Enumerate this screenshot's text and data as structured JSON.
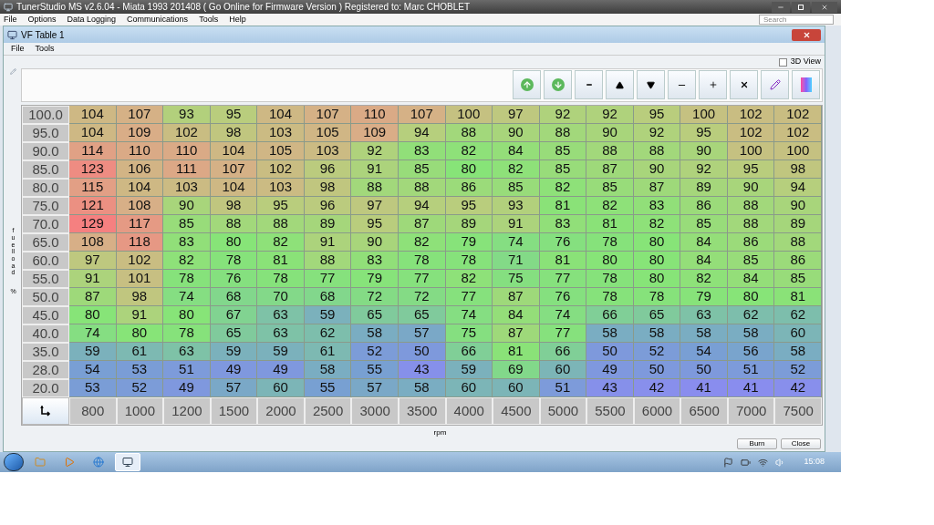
{
  "app_title": "TunerStudio MS v2.6.04 - Miata 1993 201408 ( Go Online for Firmware Version ) Registered to: Marc CHOBLET",
  "search": {
    "placeholder": "Search"
  },
  "main_menu": [
    "File",
    "Options",
    "Data Logging",
    "Communications",
    "Tools",
    "Help"
  ],
  "dialog": {
    "title": "VF Table 1",
    "menu": [
      "File",
      "Tools"
    ],
    "view_3d": {
      "label": "3D View",
      "checked": false
    },
    "y_label": "fuelload",
    "y_unit": "%",
    "x_label": "rpm",
    "rows": [
      {
        "load": "100.0",
        "cells": [
          "104",
          "107",
          "93",
          "95",
          "104",
          "107",
          "110",
          "107",
          "100",
          "97",
          "92",
          "92",
          "95",
          "100",
          "102",
          "102"
        ]
      },
      {
        "load": "95.0",
        "cells": [
          "104",
          "109",
          "102",
          "98",
          "103",
          "105",
          "109",
          "94",
          "88",
          "90",
          "88",
          "90",
          "92",
          "95",
          "102",
          "102"
        ]
      },
      {
        "load": "90.0",
        "cells": [
          "114",
          "110",
          "110",
          "104",
          "105",
          "103",
          "92",
          "83",
          "82",
          "84",
          "85",
          "88",
          "88",
          "90",
          "100",
          "100"
        ]
      },
      {
        "load": "85.0",
        "cells": [
          "123",
          "106",
          "111",
          "107",
          "102",
          "96",
          "91",
          "85",
          "80",
          "82",
          "85",
          "87",
          "90",
          "92",
          "95",
          "98"
        ]
      },
      {
        "load": "80.0",
        "cells": [
          "115",
          "104",
          "103",
          "104",
          "103",
          "98",
          "88",
          "88",
          "86",
          "85",
          "82",
          "85",
          "87",
          "89",
          "90",
          "94"
        ]
      },
      {
        "load": "75.0",
        "cells": [
          "121",
          "108",
          "90",
          "98",
          "95",
          "96",
          "97",
          "94",
          "95",
          "93",
          "81",
          "82",
          "83",
          "86",
          "88",
          "90"
        ]
      },
      {
        "load": "70.0",
        "cells": [
          "129",
          "117",
          "85",
          "88",
          "88",
          "89",
          "95",
          "87",
          "89",
          "91",
          "83",
          "81",
          "82",
          "85",
          "88",
          "89"
        ]
      },
      {
        "load": "65.0",
        "cells": [
          "108",
          "118",
          "83",
          "80",
          "82",
          "91",
          "90",
          "82",
          "79",
          "74",
          "76",
          "78",
          "80",
          "84",
          "86",
          "88"
        ]
      },
      {
        "load": "60.0",
        "cells": [
          "97",
          "102",
          "82",
          "78",
          "81",
          "88",
          "83",
          "78",
          "78",
          "71",
          "81",
          "80",
          "80",
          "84",
          "85",
          "86"
        ]
      },
      {
        "load": "55.0",
        "cells": [
          "91",
          "101",
          "78",
          "76",
          "78",
          "77",
          "79",
          "77",
          "82",
          "75",
          "77",
          "78",
          "80",
          "82",
          "84",
          "85"
        ]
      },
      {
        "load": "50.0",
        "cells": [
          "87",
          "98",
          "74",
          "68",
          "70",
          "68",
          "72",
          "72",
          "77",
          "87",
          "76",
          "78",
          "78",
          "79",
          "80",
          "81"
        ]
      },
      {
        "load": "45.0",
        "cells": [
          "80",
          "91",
          "80",
          "67",
          "63",
          "59",
          "65",
          "65",
          "74",
          "84",
          "74",
          "66",
          "65",
          "63",
          "62",
          "62"
        ]
      },
      {
        "load": "40.0",
        "cells": [
          "74",
          "80",
          "78",
          "65",
          "63",
          "62",
          "58",
          "57",
          "75",
          "87",
          "77",
          "58",
          "58",
          "58",
          "58",
          "60"
        ]
      },
      {
        "load": "35.0",
        "cells": [
          "59",
          "61",
          "63",
          "59",
          "59",
          "61",
          "52",
          "50",
          "66",
          "81",
          "66",
          "50",
          "52",
          "54",
          "56",
          "58"
        ]
      },
      {
        "load": "28.0",
        "cells": [
          "54",
          "53",
          "51",
          "49",
          "49",
          "58",
          "55",
          "43",
          "59",
          "69",
          "60",
          "49",
          "50",
          "50",
          "51",
          "52"
        ]
      },
      {
        "load": "20.0",
        "cells": [
          "53",
          "52",
          "49",
          "57",
          "60",
          "55",
          "57",
          "58",
          "60",
          "60",
          "51",
          "43",
          "42",
          "41",
          "41",
          "42"
        ]
      }
    ],
    "rpm": [
      "800",
      "1000",
      "1200",
      "1500",
      "2000",
      "2500",
      "3000",
      "3500",
      "4000",
      "4500",
      "5000",
      "5500",
      "6000",
      "6500",
      "7000",
      "7500"
    ],
    "buttons": [
      "Burn",
      "Close"
    ]
  },
  "taskbar": {
    "apps": [
      {
        "selected": false
      },
      {
        "selected": false
      },
      {
        "selected": false
      },
      {
        "selected": true
      }
    ],
    "clock": "15:08"
  }
}
